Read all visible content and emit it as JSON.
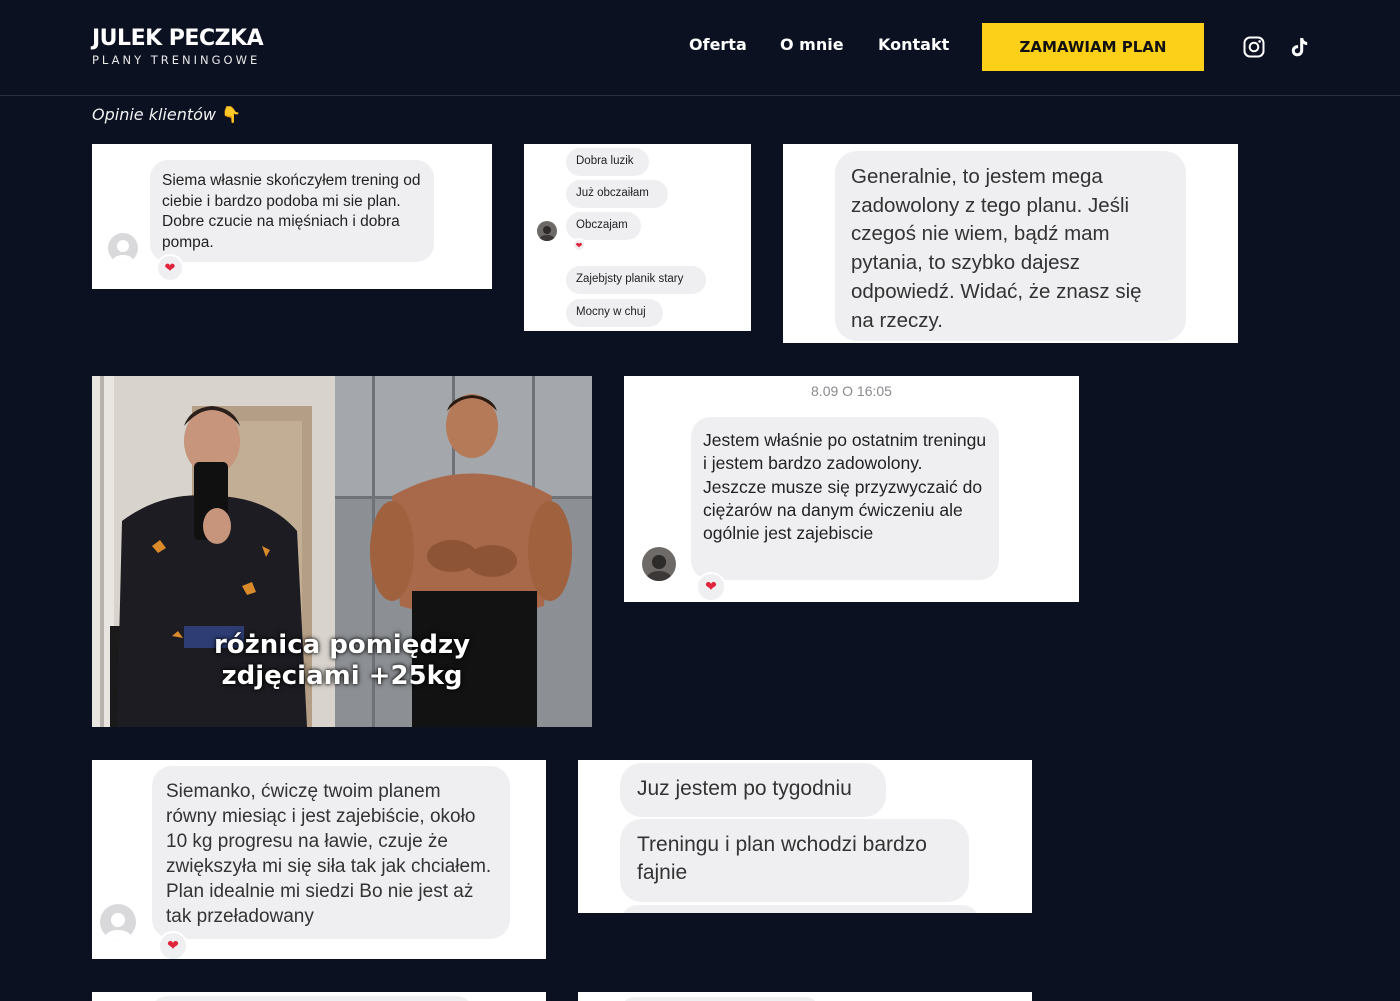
{
  "brand": {
    "title": "JULEK PECZKA",
    "subtitle": "PLANY TRENINGOWE"
  },
  "nav": {
    "items": [
      "Oferta",
      "O mnie",
      "Kontakt"
    ],
    "cta": "ZAMAWIAM PLAN"
  },
  "social": {
    "icons": [
      "instagram-icon",
      "tiktok-icon"
    ]
  },
  "colors": {
    "background": "#0c1122",
    "accent": "#fccf18",
    "heart": "#e0243c"
  },
  "section": {
    "label": "Opinie klientów",
    "emoji": "👇"
  },
  "reviews": {
    "r1": {
      "text": "Siema własnie skończyłem trening od ciebie i bardzo podoba mi sie plan. Dobre czucie na mięśniach i dobra pompa."
    },
    "r2": {
      "messages": [
        "Dobra luzik",
        "Już obczaiłam",
        "Obczajam",
        "Zajebjsty planik stary",
        "Mocny w chuj"
      ]
    },
    "r3": {
      "text": "Generalnie, to jestem mega zadowolony z tego planu. Jeśli czegoś nie wiem, bądź mam pytania, to szybko dajesz odpowiedź. Widać, że znasz się na rzeczy."
    },
    "r4": {
      "caption_line1": "różnica pomiędzy",
      "caption_line2": "zdjęciami +25kg"
    },
    "r5": {
      "timestamp": "8.09 O 16:05",
      "text": "Jestem właśnie po ostatnim treningu i jestem bardzo zadowolony. Jeszcze musze się przyzwyczaić do ciężarów na danym ćwiczeniu ale ogólnie jest zajebiscie"
    },
    "r6": {
      "text": "Siemanko, ćwiczę twoim planem równy miesiąc i jest zajebiście, około 10 kg progresu na ławie, czuje że zwiększyła mi się siła tak jak chciałem. Plan idealnie mi siedzi Bo nie jest aż tak przeładowany"
    },
    "r7": {
      "line1": "Juz jestem po tygodniu",
      "line2": "Treningu i plan wchodzi bardzo fajnie"
    }
  }
}
